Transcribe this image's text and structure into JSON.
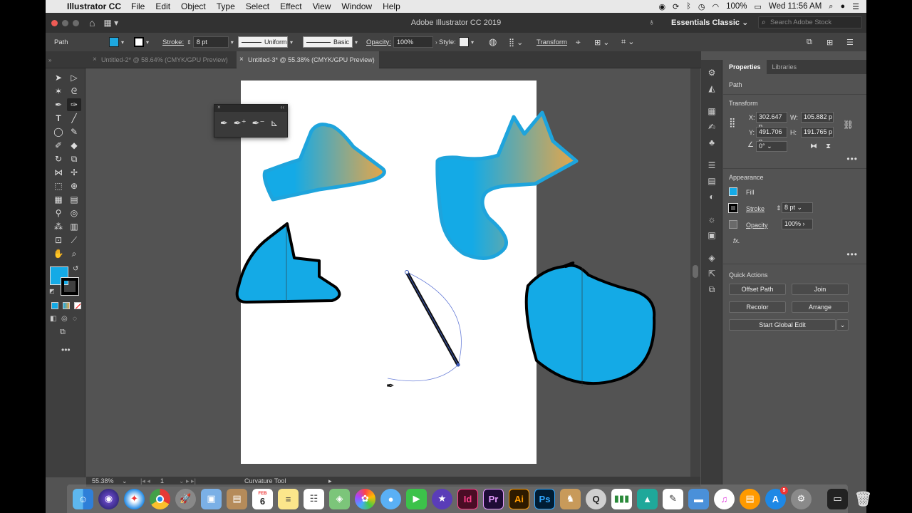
{
  "menubar": {
    "app_name": "Illustrator CC",
    "items": [
      "File",
      "Edit",
      "Object",
      "Type",
      "Select",
      "Effect",
      "View",
      "Window",
      "Help"
    ],
    "battery": "100%",
    "clock": "Wed 11:56 AM"
  },
  "titlebar": {
    "title": "Adobe Illustrator CC 2019",
    "workspace": "Essentials Classic",
    "search_placeholder": "Search Adobe Stock"
  },
  "controlbar": {
    "selection_type": "Path",
    "fill_color": "#1ea8e0",
    "stroke_label": "Stroke:",
    "stroke_weight": "8 pt",
    "profile": "Uniform",
    "brush": "Basic",
    "opacity_label": "Opacity:",
    "opacity": "100%",
    "style_label": "Style:",
    "transform_link": "Transform"
  },
  "tabs": [
    {
      "label": "Untitled-2* @ 58.64% (CMYK/GPU Preview)",
      "active": false
    },
    {
      "label": "Untitled-3* @ 55.38% (CMYK/GPU Preview)",
      "active": true
    }
  ],
  "statusbar": {
    "zoom": "55.38%",
    "artboard": "1",
    "tool": "Curvature Tool"
  },
  "properties": {
    "tabs": [
      "Properties",
      "Libraries"
    ],
    "selection_type": "Path",
    "transform_header": "Transform",
    "x_label": "X:",
    "x": "302.647 p",
    "y_label": "Y:",
    "y": "491.706 p",
    "w_label": "W:",
    "w": "105.882 p",
    "h_label": "H:",
    "h": "191.765 p",
    "angle": "0°",
    "appearance_header": "Appearance",
    "fill_label": "Fill",
    "stroke_label": "Stroke",
    "stroke_weight": "8 pt",
    "opacity_label": "Opacity",
    "opacity": "100%",
    "fx": "fx.",
    "quick_actions_header": "Quick Actions",
    "buttons": {
      "offset_path": "Offset Path",
      "join": "Join",
      "recolor": "Recolor",
      "arrange": "Arrange",
      "global_edit": "Start Global Edit"
    }
  },
  "colors": {
    "accent_blue": "#14aae6",
    "gradient_end": "#e8a647",
    "stroke_blue": "#1ea4dc"
  },
  "dock": {
    "apps": [
      "finder",
      "siri",
      "safari",
      "chrome",
      "launchpad",
      "preview",
      "contacts",
      "calendar",
      "notes",
      "reminders",
      "maps",
      "photos",
      "messages",
      "facetime",
      "imovie",
      "indesign",
      "premiere",
      "illustrator",
      "photoshop",
      "cinema",
      "quicktime",
      "numbers",
      "maya",
      "textedit",
      "keynote",
      "itunes",
      "ibooks",
      "appstore",
      "preferences",
      "screenshot",
      "trash"
    ],
    "id": "Id",
    "pr": "Pr",
    "ai": "Ai",
    "ps": "Ps",
    "calendar_month": "FEB",
    "calendar_day": "6",
    "appstore_badge": "5"
  }
}
